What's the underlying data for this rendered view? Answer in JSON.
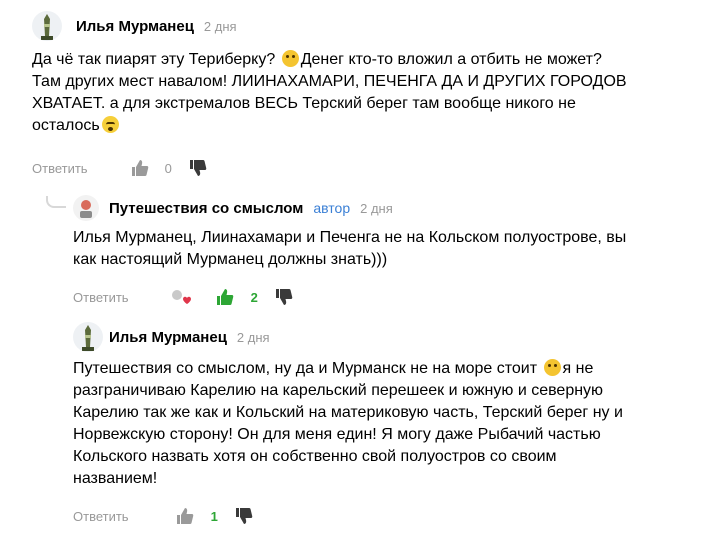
{
  "comments": [
    {
      "author": "Илья Мурманец",
      "date": "2 дня",
      "text_1": "Да чё так пиарят эту Териберку? ",
      "text_2": "Денег кто-то вложил а отбить не может? Там других мест навалом! ЛИИНАХАМАРИ, ПЕЧЕНГА ДА И ДРУГИХ ГОРОДОВ ХВАТАЕТ. а для экстремалов ВЕСЬ Терский берег там вообще никого не осталось",
      "reply_label": "Ответить",
      "likes": "0"
    },
    {
      "author": "Путешествия со смыслом",
      "badge": "автор",
      "date": "2 дня",
      "text": "Илья Мурманец, Лиинахамари и Печенга не на Кольском полуострове, вы как настоящий Мурманец должны знать)))",
      "reply_label": "Ответить",
      "likes": "2"
    },
    {
      "author": "Илья Мурманец",
      "date": "2 дня",
      "text_1": "Путешествия со смыслом, ну да и Мурманск не на море стоит ",
      "text_2": "я не разграничиваю Карелию на карельский перешеек и южную и северную Карелию так же как и Кольский на материковую часть, Терский берег ну и Норвежскую сторону! Он для меня един! Я могу даже Рыбачий частью Кольского назвать хотя он собственно свой полуостров со своим названием!",
      "reply_label": "Ответить",
      "likes": "1"
    }
  ],
  "colors": {
    "accent": "#3a7fd5",
    "like_active": "#2da635",
    "muted": "#999999"
  },
  "icons": {
    "like": "thumbs-up-icon",
    "dislike": "thumbs-down-icon",
    "avatar_1": "lighthouse-avatar",
    "avatar_2": "travel-avatar"
  }
}
